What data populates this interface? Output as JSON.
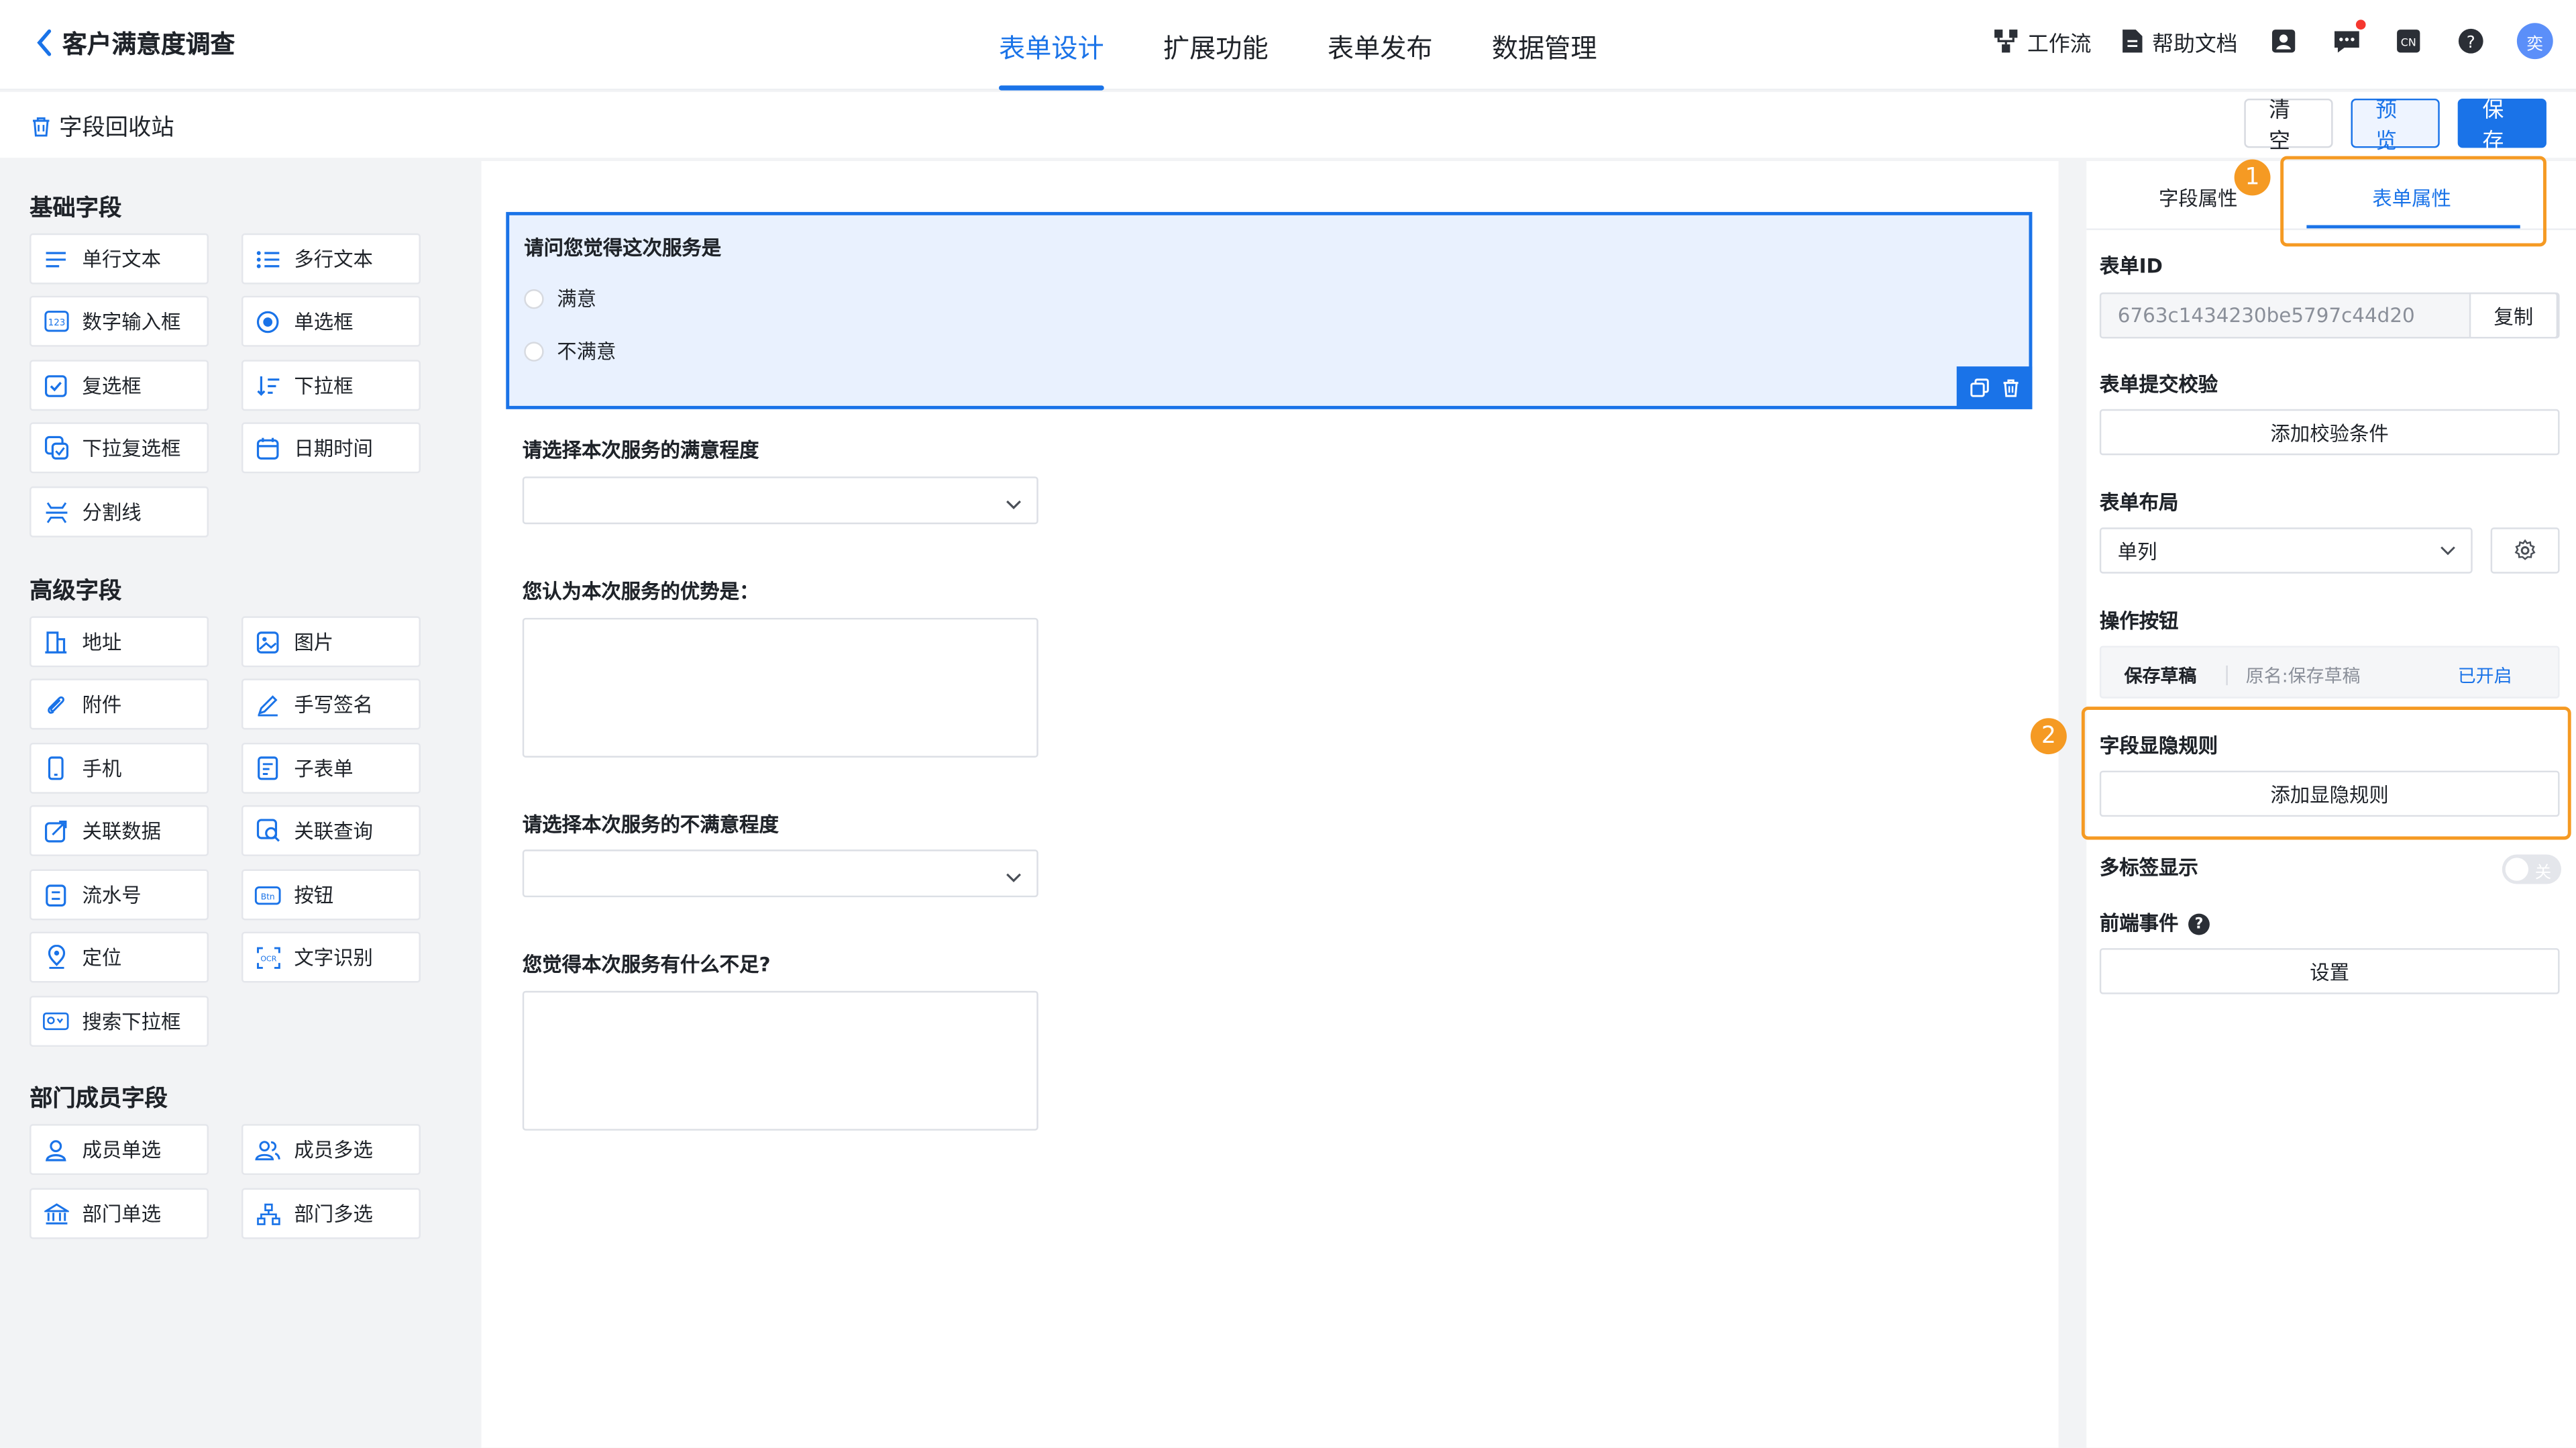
{
  "header": {
    "title": "客户满意度调查",
    "tabs": [
      {
        "label": "表单设计",
        "active": true
      },
      {
        "label": "扩展功能",
        "active": false
      },
      {
        "label": "表单发布",
        "active": false
      },
      {
        "label": "数据管理",
        "active": false
      }
    ],
    "workflow_label": "工作流",
    "help_docs_label": "帮助文档",
    "avatar_text": "奕"
  },
  "subbar": {
    "recycle_label": "字段回收站",
    "clear_label": "清空",
    "preview_label": "预览",
    "save_label": "保存"
  },
  "palette": {
    "basic_title": "基础字段",
    "basic": [
      "单行文本",
      "多行文本",
      "数字输入框",
      "单选框",
      "复选框",
      "下拉框",
      "下拉复选框",
      "日期时间",
      "分割线"
    ],
    "advanced_title": "高级字段",
    "advanced": [
      "地址",
      "图片",
      "附件",
      "手写签名",
      "手机",
      "子表单",
      "关联数据",
      "关联查询",
      "流水号",
      "按钮",
      "定位",
      "文字识别",
      "搜索下拉框"
    ],
    "member_title": "部门成员字段",
    "member": [
      "成员单选",
      "成员多选",
      "部门单选",
      "部门多选"
    ]
  },
  "form": {
    "q1_title": "请问您觉得这次服务是",
    "q1_options": [
      "满意",
      "不满意"
    ],
    "q2_title": "请选择本次服务的满意程度",
    "q3_title": "您认为本次服务的优势是：",
    "q4_title": "请选择本次服务的不满意程度",
    "q5_title": "您觉得本次服务有什么不足?"
  },
  "right": {
    "tab_field": "字段属性",
    "tab_form": "表单属性",
    "form_id_label": "表单ID",
    "form_id_value": "6763c1434230be5797c44d20",
    "copy_label": "复制",
    "submit_check_label": "表单提交校验",
    "add_check_label": "添加校验条件",
    "layout_label": "表单布局",
    "layout_value": "单列",
    "op_buttons_label": "操作按钮",
    "op_name": "保存草稿",
    "op_original": "原名:保存草稿",
    "op_status": "已开启",
    "visibility_label": "字段显隐规则",
    "add_visibility_label": "添加显隐规则",
    "multitab_label": "多标签显示",
    "multitab_state": "关",
    "frontend_event_label": "前端事件",
    "settings_label": "设置"
  },
  "annotations": {
    "badge1": "1",
    "badge2": "2"
  },
  "colors": {
    "accent": "#1a73e8",
    "highlight": "#f59a23",
    "selected_bg": "#e9f1fe"
  }
}
